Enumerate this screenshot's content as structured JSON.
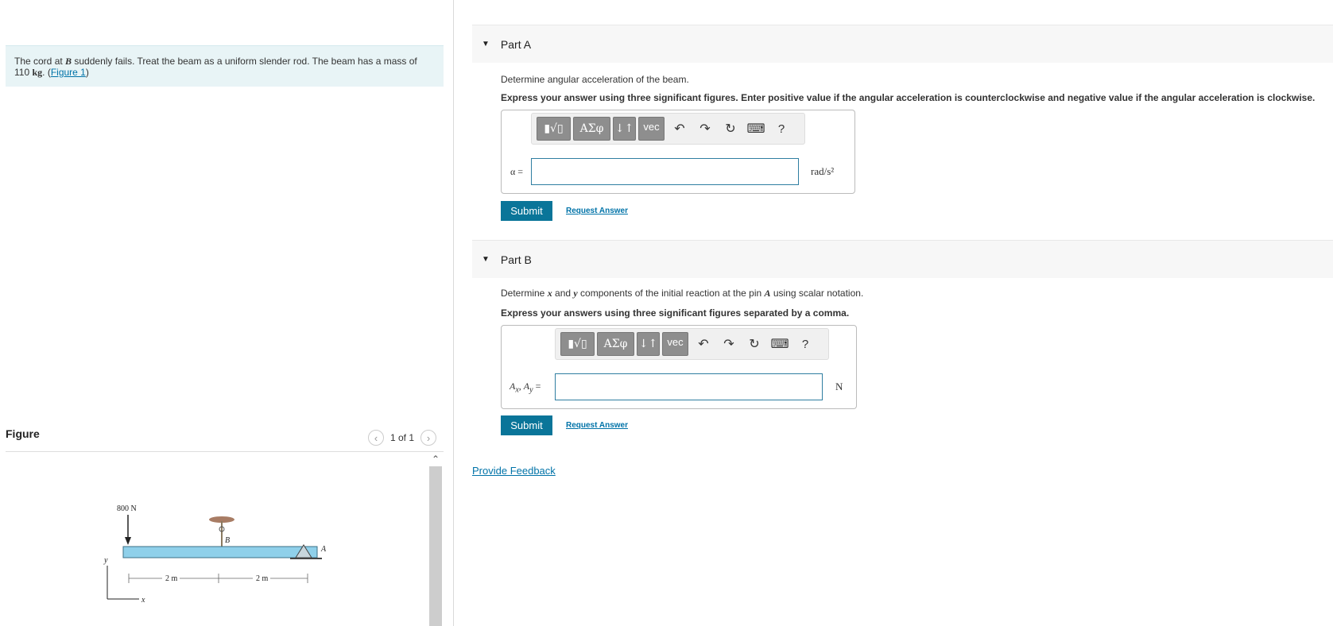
{
  "problem": {
    "text_before_B": "The cord at ",
    "B": "B",
    "text_after_B": " suddenly fails. Treat the beam as a uniform slender rod. The beam has a mass of 110 ",
    "unit": "kg",
    "dot": ". (",
    "link": "Figure 1",
    "close": ")"
  },
  "figure_panel": {
    "title": "Figure",
    "pager": "1 of 1",
    "prev_icon": "chevron-left-icon",
    "next_icon": "chevron-right-icon",
    "scroll_up_icon": "chevron-up-icon",
    "diagram": {
      "force_label": "800 N",
      "point_B": "B",
      "point_A": "A",
      "dim1": "2 m",
      "dim2": "2 m",
      "axis_y": "y",
      "axis_x": "x"
    }
  },
  "toolbar": {
    "templates_icon": "fraction-root-icon",
    "greek": "ΑΣφ",
    "arrows": "↓↑",
    "vec": "vec",
    "undo_icon": "undo-icon",
    "redo_icon": "redo-icon",
    "reset_icon": "reset-icon",
    "keyboard_icon": "keyboard-icon",
    "help": "?"
  },
  "partA": {
    "title": "Part A",
    "question": "Determine angular acceleration of the beam.",
    "express": "Express your answer using three significant figures. Enter positive value if the angular acceleration is counterclockwise and negative value if the angular acceleration is clockwise.",
    "label": "α =",
    "value": "",
    "unit": "rad/s²",
    "submit": "Submit",
    "request": "Request Answer"
  },
  "partB": {
    "title": "Part B",
    "q1": "Determine ",
    "x": "x",
    "q2": " and ",
    "y": "y",
    "q3": " components of the initial reaction at the pin ",
    "A": "A",
    "q4": " using scalar notation.",
    "express": "Express your answers using three significant figures separated by a comma.",
    "label_ax": "A",
    "sub_x": "x",
    "comma": ", ",
    "label_ay": "A",
    "sub_y": "y",
    "eq": " =",
    "value": "",
    "unit": "N",
    "submit": "Submit",
    "request": "Request Answer"
  },
  "feedback": "Provide Feedback",
  "colors": {
    "accent": "#0a7599",
    "link": "#0073a8",
    "problem_bg": "#e8f4f6"
  }
}
